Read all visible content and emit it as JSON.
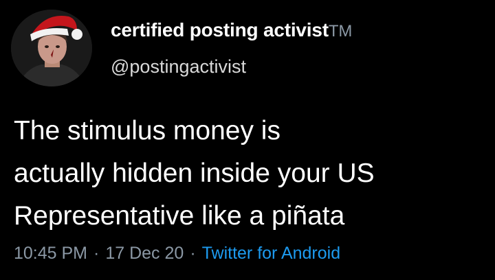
{
  "user": {
    "display_name": "certified posting activist",
    "trademark": "TM",
    "handle": "@postingactivist",
    "avatar_icon": "profile-photo-santa-hat"
  },
  "tweet": {
    "lines": [
      "The stimulus money is",
      "actually hidden inside your US",
      "Representative like a piñata"
    ]
  },
  "meta": {
    "time": "10:45 PM",
    "separator": "·",
    "date": "17 Dec 20",
    "source": "Twitter for Android"
  },
  "colors": {
    "background": "#000000",
    "text": "#ffffff",
    "secondary": "#8b98a5",
    "link": "#1d9bf0"
  }
}
